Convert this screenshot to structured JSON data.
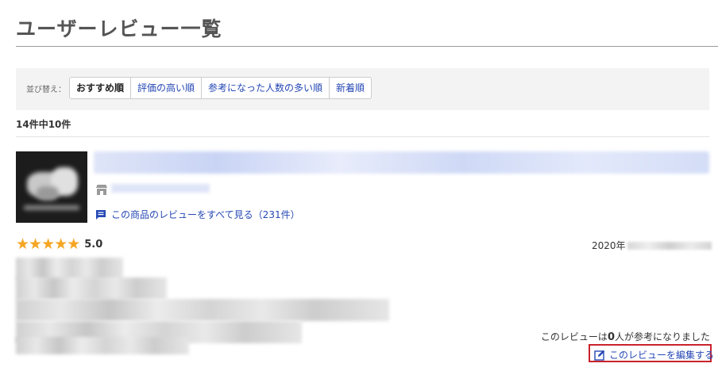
{
  "page": {
    "title": "ユーザーレビュー一覧"
  },
  "sort": {
    "label": "並び替え：",
    "options": [
      "おすすめ順",
      "評価の高い順",
      "参考になった人数の多い順",
      "新着順"
    ],
    "selected": "おすすめ順"
  },
  "results": {
    "count_text": "14件中10件"
  },
  "review": {
    "product": {
      "all_reviews_link": "この商品のレビューをすべて見る（231件）",
      "shop_icon": "shop-icon",
      "review_icon": "review-list-icon"
    },
    "rating": {
      "stars": 5,
      "max_stars": 5,
      "value": "5.0"
    },
    "date_prefix": "2020年",
    "helpful": {
      "prefix": "このレビューは",
      "count": "0",
      "suffix": "人が参考になりました"
    },
    "edit_link": "このレビューを編集する",
    "edit_icon": "edit-icon"
  },
  "colors": {
    "link": "#2548b5",
    "star": "#f5a623",
    "highlight_border": "#c8232c",
    "title": "#555555"
  }
}
